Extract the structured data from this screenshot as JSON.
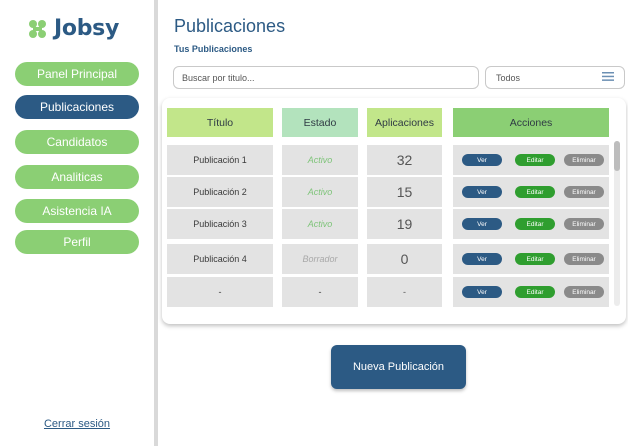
{
  "brand": {
    "name": "Jobsy"
  },
  "sidebar": {
    "items": [
      {
        "label": "Panel Principal",
        "active": false
      },
      {
        "label": "Publicaciones",
        "active": true
      },
      {
        "label": "Candidatos",
        "active": false
      },
      {
        "label": "Analiticas",
        "active": false
      },
      {
        "label": "Asistencia IA",
        "active": false
      },
      {
        "label": "Perfil",
        "active": false
      }
    ],
    "logout_label": "Cerrar sesión"
  },
  "header": {
    "title": "Publicaciones",
    "section_label": "Tus Publicaciones"
  },
  "search": {
    "placeholder": "Buscar por titulo..."
  },
  "filter": {
    "selected": "Todos",
    "icon": "menu-icon"
  },
  "table": {
    "columns": [
      "Título",
      "Estado",
      "Aplicaciones",
      "Acciones"
    ],
    "rows": [
      {
        "titulo": "Publicación 1",
        "estado": "Activo",
        "aplicaciones": "32"
      },
      {
        "titulo": "Publicación 2",
        "estado": "Activo",
        "aplicaciones": "15"
      },
      {
        "titulo": "Publicación 3",
        "estado": "Activo",
        "aplicaciones": "19"
      },
      {
        "titulo": "Publicación 4",
        "estado": "Borrador",
        "aplicaciones": "0"
      },
      {
        "titulo": "-",
        "estado": "-",
        "aplicaciones": "-"
      }
    ],
    "actions": {
      "view": "Ver",
      "edit": "Editar",
      "delete": "Eliminar"
    }
  },
  "new_button": {
    "label": "Nueva Publicación"
  },
  "colors": {
    "primary": "#2c5a84",
    "green": "#8bcf74",
    "header_lime": "#c2e68a",
    "header_mint": "#b3e3bd",
    "header_green": "#8bcf74",
    "active_text": "#7fc47a",
    "draft_text": "#a9a9a9",
    "edit_green": "#2f9e2f",
    "delete_grey": "#8a8a8a"
  }
}
